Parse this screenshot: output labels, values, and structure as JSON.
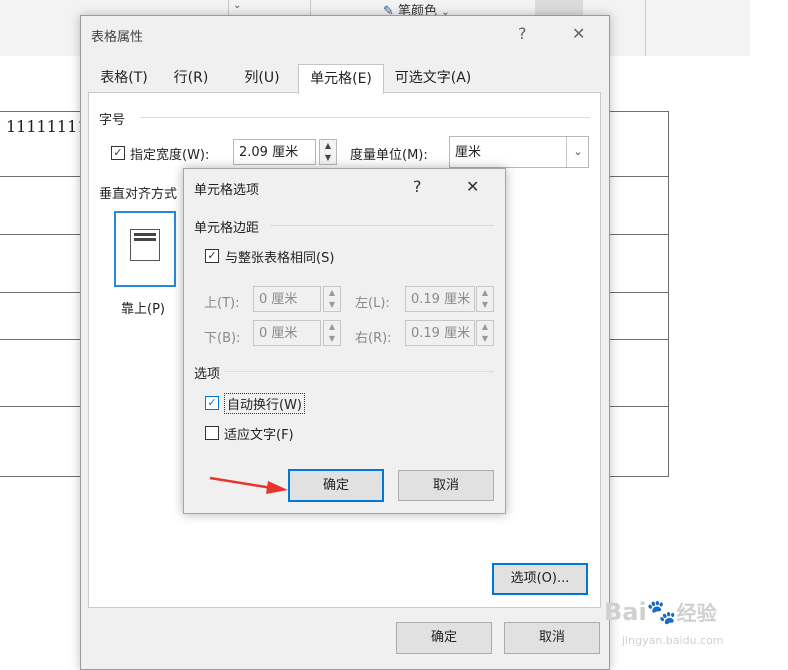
{
  "ribbon": {
    "font_color_label": "笔颜色"
  },
  "document": {
    "cell_text": "11111111"
  },
  "dialog": {
    "title": "表格属性",
    "help": "?",
    "close": "✕",
    "tabs": [
      "表格(T)",
      "行(R)",
      "列(U)",
      "单元格(E)",
      "可选文字(A)"
    ],
    "active_tab": "单元格(E)",
    "size_section": "字号",
    "preferred_width_label": "指定宽度(W):",
    "preferred_width_value": "2.09 厘米",
    "measure_label": "度量单位(M):",
    "measure_value": "厘米",
    "valign_section": "垂直对齐方式",
    "valign_top_label": "靠上(P)",
    "options_button": "选项(O)...",
    "ok": "确定",
    "cancel": "取消"
  },
  "cell_options": {
    "title": "单元格选项",
    "help": "?",
    "close": "✕",
    "margins_section": "单元格边距",
    "same_as_table_label": "与整张表格相同(S)",
    "same_as_table_checked": true,
    "top_label": "上(T):",
    "top_value": "0 厘米",
    "bottom_label": "下(B):",
    "bottom_value": "0 厘米",
    "left_label": "左(L):",
    "left_value": "0.19 厘米",
    "right_label": "右(R):",
    "right_value": "0.19 厘米",
    "options_section": "选项",
    "wrap_text_label": "自动换行(W)",
    "wrap_text_checked": true,
    "fit_text_label": "适应文字(F)",
    "fit_text_checked": false,
    "ok": "确定",
    "cancel": "取消"
  },
  "watermark": {
    "brand": "Bai",
    "brand2": "经验",
    "url": "jingyan.baidu.com"
  },
  "colors": {
    "accent": "#0078d7",
    "arrow": "#e8352b"
  }
}
